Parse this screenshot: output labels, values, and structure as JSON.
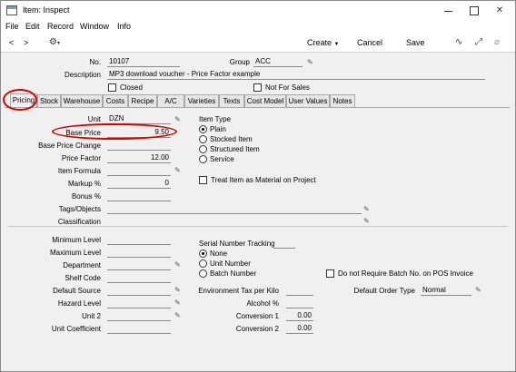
{
  "window": {
    "title": "Item: Inspect"
  },
  "menu": [
    "File",
    "Edit",
    "Record",
    "Window",
    "Info"
  ],
  "toolbar": {
    "prev": "<",
    "next": ">",
    "create": "Create",
    "cancel": "Cancel",
    "save": "Save"
  },
  "header": {
    "no_label": "No.",
    "no_value": "10107",
    "group_label": "Group",
    "group_value": "ACC",
    "description_label": "Description",
    "description_value": "MP3 download voucher - Price Factor example",
    "closed_label": "Closed",
    "not_for_sales_label": "Not For Sales"
  },
  "tabs": [
    "Pricing",
    "Stock",
    "Warehouse",
    "Costs",
    "Recipe",
    "A/C",
    "Varieties",
    "Texts",
    "Cost Model",
    "User Values",
    "Notes"
  ],
  "pricing": {
    "unit_label": "Unit",
    "unit_value": "DZN",
    "base_price_label": "Base Price",
    "base_price_value": "9.50",
    "base_price_change_label": "Base Price Change",
    "price_factor_label": "Price Factor",
    "price_factor_value": "12.00",
    "item_formula_label": "Item Formula",
    "markup_label": "Markup %",
    "markup_value": "0",
    "bonus_label": "Bonus %",
    "tags_label": "Tags/Objects",
    "classification_label": "Classification",
    "item_type_label": "Item Type",
    "item_types": [
      "Plain",
      "Stocked Item",
      "Structured Item",
      "Service"
    ],
    "treat_as_material_label": "Treat Item as Material on Project"
  },
  "lower": {
    "minimum_level_label": "Minimum Level",
    "maximum_level_label": "Maximum Level",
    "department_label": "Department",
    "shelf_code_label": "Shelf Code",
    "default_source_label": "Default Source",
    "hazard_level_label": "Hazard Level",
    "unit2_label": "Unit 2",
    "unit_coefficient_label": "Unit Coefficient",
    "serial_tracking_label": "Serial Number Tracking",
    "serial_options": [
      "None",
      "Unit Number",
      "Batch Number"
    ],
    "env_tax_label": "Environment Tax per Kilo",
    "alcohol_label": "Alcohol %",
    "conversion1_label": "Conversion 1",
    "conversion1_value": "0.00",
    "conversion2_label": "Conversion 2",
    "conversion2_value": "0.00",
    "no_batch_label": "Do not Require Batch No. on POS Invoice",
    "default_order_type_label": "Default Order Type",
    "default_order_type_value": "Normal"
  },
  "colors": {
    "annotation": "#d60000",
    "window_bg": "#f0f0f0"
  },
  "icons": [
    "app-icon",
    "gear-icon",
    "pulse-icon",
    "expand-icon",
    "paperclip-icon",
    "paste-icon"
  ]
}
